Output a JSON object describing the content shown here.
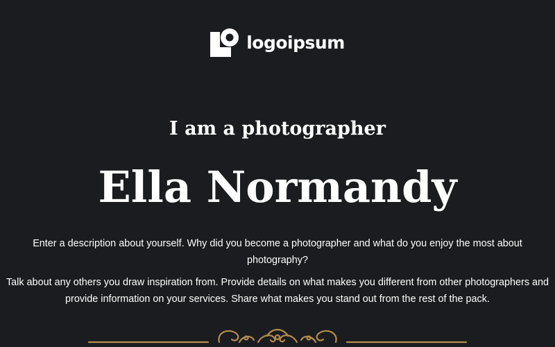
{
  "brand": {
    "name": "logoipsum",
    "logo_icon": "logo-mark-icon"
  },
  "hero": {
    "subtitle": "I am a photographer",
    "name": "Ella Normandy"
  },
  "about": {
    "paragraph_1": "Enter a description about yourself. Why did you become a photographer and what do you enjoy the most about photography?",
    "paragraph_2": "Talk about any others you draw inspiration from. Provide details on what makes you different from other photographers and provide information on your services. Share what makes you stand out from the rest of the pack."
  },
  "colors": {
    "background": "#1b1c1f",
    "text": "#ffffff",
    "ornament": "#b48d4e"
  },
  "divider": {
    "icon": "ornamental-divider-icon"
  }
}
